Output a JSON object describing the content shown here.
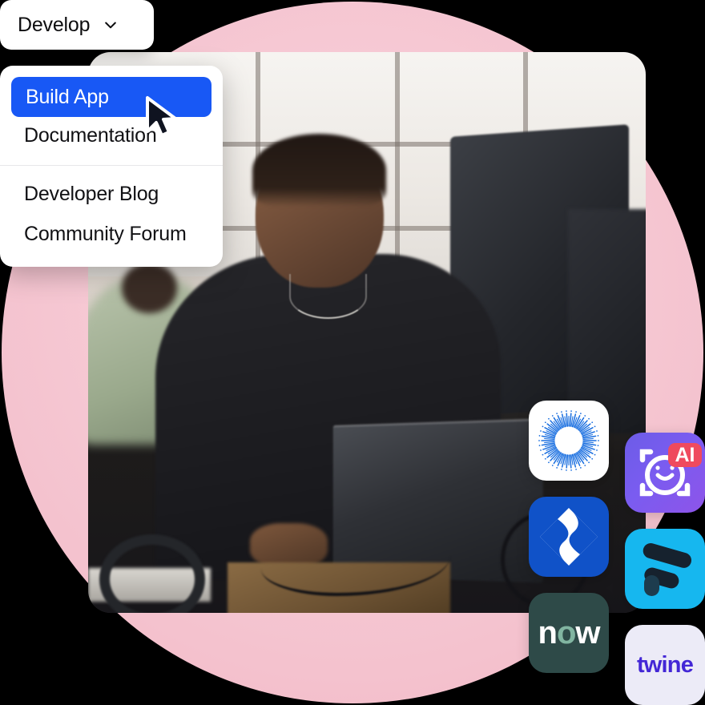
{
  "background": {
    "canvas_color": "#000000",
    "blob_color": "#f4c2ce",
    "blob_shape": "circle"
  },
  "dropdown_trigger": {
    "label": "Develop",
    "icon": "chevron-down-icon",
    "background": "#ffffff",
    "text_color": "#0d0d0f"
  },
  "menu": {
    "background": "#ffffff",
    "highlight_color": "#1858f5",
    "groups": [
      {
        "items": [
          {
            "label": "Build App",
            "active": true
          },
          {
            "label": "Documentation",
            "active": false
          }
        ]
      },
      {
        "items": [
          {
            "label": "Developer Blog",
            "active": false
          },
          {
            "label": "Community Forum",
            "active": false
          }
        ]
      }
    ]
  },
  "cursor": {
    "icon": "mouse-pointer-icon",
    "fill": "#0f1320",
    "stroke": "#ffffff"
  },
  "photo": {
    "alt": "Developer working at a desk with a laptop and monitors in an office",
    "corner_radius": "28px"
  },
  "app_tiles": [
    {
      "name": "radial-sunburst-icon",
      "label": "",
      "background": "#ffffff",
      "accent": "#1a6fe0"
    },
    {
      "name": "ai-face-scan-icon",
      "label": "AI",
      "background": "#7a5cf0",
      "accent": "#ef4a5e"
    },
    {
      "name": "jira-diamond-icon",
      "label": "",
      "background": "#1052c8",
      "accent": "#ffffff"
    },
    {
      "name": "f-mark-icon",
      "label": "",
      "background": "#16b7ef",
      "accent": "#16222e"
    },
    {
      "name": "servicenow-icon",
      "label": "now",
      "background": "#2e4a48",
      "accent": "#81b5a1"
    },
    {
      "name": "twine-icon",
      "label": "twine",
      "background": "#ecebf7",
      "accent": "#4327d6"
    }
  ]
}
